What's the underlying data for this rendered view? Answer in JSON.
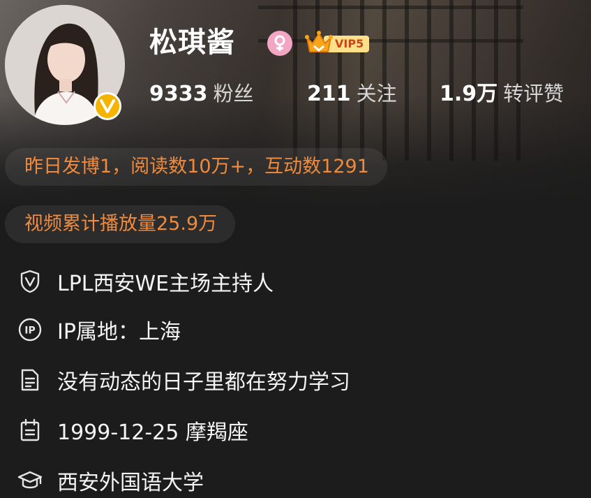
{
  "profile": {
    "name": "松琪酱",
    "vip_label": "VIP5",
    "followers_count": "9333",
    "followers_label": "粉丝",
    "following_count": "211",
    "following_label": "关注",
    "interactions_count": "1.9万",
    "interactions_label": "转评赞"
  },
  "highlights": {
    "yesterday": "昨日发博1，阅读数10万+，互动数1291",
    "video": "视频累计播放量25.9万"
  },
  "info": {
    "verification": "LPL西安WE主场主持人",
    "ip_location": "IP属地：上海",
    "bio": "没有动态的日子里都在努力学习",
    "birthday": "1999-12-25 摩羯座",
    "school": "西安外国语大学"
  },
  "icons": {
    "verified": "verified-v-badge-icon",
    "gender": "female-icon",
    "vip": "crown-icon",
    "verification": "shield-v-icon",
    "ip": "ip-circle-icon",
    "bio": "document-icon",
    "birthday": "calendar-icon",
    "school": "graduation-cap-icon"
  },
  "colors": {
    "accent_orange": "#f08a3c",
    "verified_gold": "#f5b400",
    "female_pink": "#f2a6c3",
    "vip_red": "#c8461b",
    "background": "#1c1c1c"
  }
}
